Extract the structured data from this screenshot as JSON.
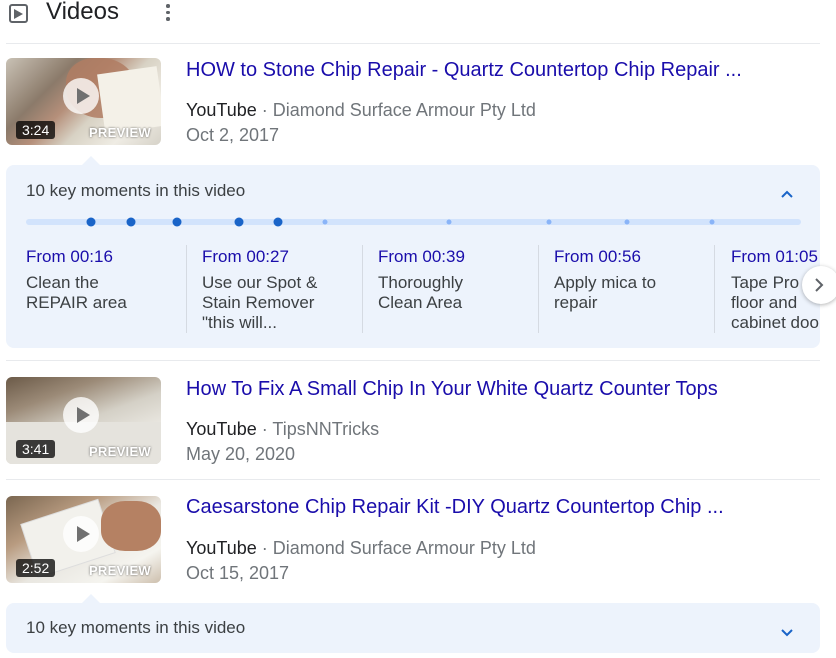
{
  "header": {
    "title": "Videos",
    "icon": "video-play-icon",
    "more_icon": "more-vert-icon"
  },
  "colors": {
    "link": "#1a0dab",
    "meta": "#70757a",
    "panel": "#edf3fc",
    "dot_active": "#1a64c8",
    "dot_inactive": "#8ab4f8"
  },
  "videos": [
    {
      "title": "HOW to Stone Chip Repair - Quartz Countertop Chip Repair ...",
      "source": "YouTube",
      "channel": "· Diamond Surface Armour Pty Ltd",
      "date": "Oct 2, 2017",
      "duration": "3:24",
      "preview": "PREVIEW"
    },
    {
      "title": "How To Fix A Small Chip In Your White Quartz Counter Tops",
      "source": "YouTube",
      "channel": "· TipsNNTricks",
      "date": "May 20, 2020",
      "duration": "3:41",
      "preview": "PREVIEW"
    },
    {
      "title": "Caesarstone Chip Repair Kit -DIY Quartz Countertop Chip ...",
      "source": "YouTube",
      "channel": "· Diamond Surface Armour Pty Ltd",
      "date": "Oct 15, 2017",
      "duration": "2:52",
      "preview": "PREVIEW"
    }
  ],
  "key_moments_1": {
    "label": "10 key moments in this video",
    "expanded": true,
    "moments": [
      {
        "from": "From 00:16",
        "desc": "Clean the\nREPAIR area"
      },
      {
        "from": "From 00:27",
        "desc": "Use our Spot &\nStain Remover\n\"this will..."
      },
      {
        "from": "From 00:39",
        "desc": "Thoroughly\nClean Area"
      },
      {
        "from": "From 00:56",
        "desc": "Apply mica to\nrepair"
      },
      {
        "from": "From 01:05",
        "desc": "Tape Pro\nfloor and\ncabinet doo"
      }
    ]
  },
  "key_moments_2": {
    "label": "10 key moments in this video",
    "expanded": false
  }
}
